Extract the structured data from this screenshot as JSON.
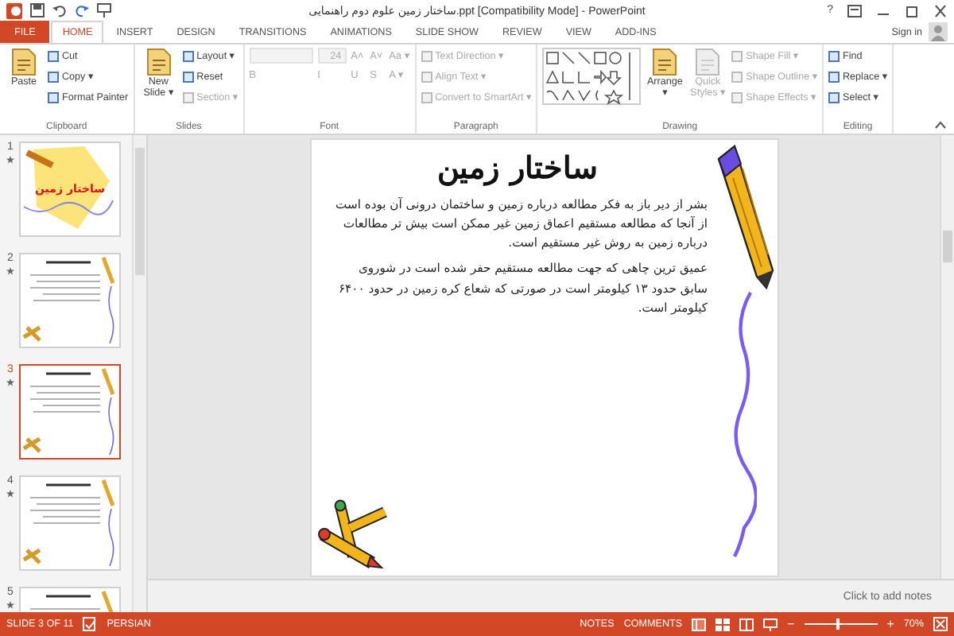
{
  "window": {
    "title": "ساختار زمین علوم دوم راهنمایی.ppt [Compatibility Mode] - PowerPoint",
    "help": "?"
  },
  "tabs": [
    {
      "label": "FILE",
      "kind": "file",
      "selected": false
    },
    {
      "label": "HOME",
      "kind": "tab",
      "selected": true
    },
    {
      "label": "INSERT",
      "kind": "tab",
      "selected": false
    },
    {
      "label": "DESIGN",
      "kind": "tab",
      "selected": false
    },
    {
      "label": "TRANSITIONS",
      "kind": "tab",
      "selected": false
    },
    {
      "label": "ANIMATIONS",
      "kind": "tab",
      "selected": false
    },
    {
      "label": "SLIDE SHOW",
      "kind": "tab",
      "selected": false
    },
    {
      "label": "REVIEW",
      "kind": "tab",
      "selected": false
    },
    {
      "label": "VIEW",
      "kind": "tab",
      "selected": false
    },
    {
      "label": "ADD-INS",
      "kind": "tab",
      "selected": false
    }
  ],
  "sign_in": "Sign in",
  "ribbon": {
    "groups": [
      {
        "label": "Clipboard",
        "columns": [
          [
            {
              "kind": "large",
              "label": "Paste",
              "disabled": false
            }
          ],
          [
            {
              "kind": "small",
              "label": "Cut",
              "disabled": false
            },
            {
              "kind": "small",
              "label": "Copy ▾",
              "disabled": false
            },
            {
              "kind": "small",
              "label": "Format Painter",
              "disabled": false
            }
          ]
        ]
      },
      {
        "label": "Slides",
        "columns": [
          [
            {
              "kind": "large",
              "label": "New Slide ▾",
              "disabled": false
            }
          ],
          [
            {
              "kind": "small",
              "label": "Layout ▾",
              "disabled": false
            },
            {
              "kind": "small",
              "label": "Reset",
              "disabled": false
            },
            {
              "kind": "small",
              "label": "Section ▾",
              "disabled": true
            }
          ]
        ]
      },
      {
        "label": "Font",
        "columns": [
          [
            {
              "kind": "field",
              "disabled": true
            },
            {
              "kind": "glyph",
              "label": "B",
              "disabled": true
            }
          ],
          [
            {
              "kind": "field",
              "value": "24",
              "disabled": true
            },
            {
              "kind": "glyph",
              "label": "I",
              "disabled": true
            }
          ],
          [
            {
              "kind": "glyph",
              "label": "A˄",
              "disabled": true
            },
            {
              "kind": "glyph",
              "label": "U",
              "disabled": true
            }
          ],
          [
            {
              "kind": "glyph",
              "label": "A˅",
              "disabled": true
            },
            {
              "kind": "glyph",
              "label": "S",
              "disabled": true
            }
          ],
          [
            {
              "kind": "glyph",
              "label": "Aa ▾",
              "disabled": true
            },
            {
              "kind": "glyph",
              "label": "A ▾",
              "disabled": true
            }
          ]
        ]
      },
      {
        "label": "Paragraph",
        "columns": [
          [
            {
              "kind": "small",
              "label": "Text Direction ▾",
              "disabled": true
            },
            {
              "kind": "small",
              "label": "Align Text ▾",
              "disabled": true
            },
            {
              "kind": "small",
              "label": "Convert to SmartArt ▾",
              "disabled": true
            }
          ]
        ]
      },
      {
        "label": "Drawing",
        "columns": [
          [
            {
              "kind": "gallery",
              "disabled": false
            }
          ],
          [
            {
              "kind": "large",
              "label": "Arrange ▾",
              "disabled": false
            }
          ],
          [
            {
              "kind": "large",
              "label": "Quick Styles ▾",
              "disabled": true
            }
          ],
          [
            {
              "kind": "small",
              "label": "Shape Fill ▾",
              "disabled": true
            },
            {
              "kind": "small",
              "label": "Shape Outline ▾",
              "disabled": true
            },
            {
              "kind": "small",
              "label": "Shape Effects ▾",
              "disabled": true
            }
          ]
        ]
      },
      {
        "label": "Editing",
        "columns": [
          [
            {
              "kind": "small",
              "label": "Find",
              "disabled": false
            },
            {
              "kind": "small",
              "label": "Replace ▾",
              "disabled": false
            },
            {
              "kind": "small",
              "label": "Select ▾",
              "disabled": false
            }
          ]
        ]
      }
    ]
  },
  "slides": [
    {
      "number": "1",
      "kind": "title",
      "title": "ساختار زمین",
      "selected": false
    },
    {
      "number": "2",
      "kind": "content",
      "selected": false
    },
    {
      "number": "3",
      "kind": "content",
      "selected": true
    },
    {
      "number": "4",
      "kind": "content",
      "selected": false
    },
    {
      "number": "5",
      "kind": "content",
      "selected": false
    }
  ],
  "slide": {
    "title": "ساختار زمین",
    "paragraphs": [
      "بشر از دیر باز به فکر مطالعه درباره زمین و ساختمان درونی آن بوده است از آنجا که مطالعه مستقیم اعماق زمین غیر ممکن است بیش تر مطالعات درباره زمین به روش غیر مستقیم است.",
      "عمیق ترین چاهی که جهت مطالعه مستقیم حفر شده است در شوروی سابق حدود ۱۳ کیلومتر است در صورتی که شعاع کره زمین در حدود ۶۴۰۰ کیلومتر است."
    ]
  },
  "notes": {
    "placeholder": "Click to add notes"
  },
  "status_bar": {
    "slide": "SLIDE 3 OF 11",
    "language": "PERSIAN",
    "notes": "NOTES",
    "comments": "COMMENTS",
    "zoom_out": "−",
    "zoom_in": "+",
    "zoom": "70%",
    "level": 0.45
  }
}
